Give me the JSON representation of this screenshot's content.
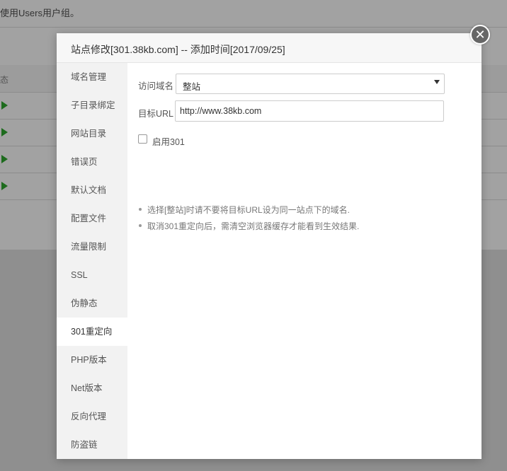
{
  "background": {
    "note": "使用Users用户组。",
    "table_header": "态"
  },
  "modal": {
    "title": "站点修改[301.38kb.com] -- 添加时间[2017/09/25]",
    "close_icon": "close-icon",
    "sidebar": {
      "items": [
        {
          "label": "域名管理",
          "active": false
        },
        {
          "label": "子目录绑定",
          "active": false
        },
        {
          "label": "网站目录",
          "active": false
        },
        {
          "label": "错误页",
          "active": false
        },
        {
          "label": "默认文档",
          "active": false
        },
        {
          "label": "配置文件",
          "active": false
        },
        {
          "label": "流量限制",
          "active": false
        },
        {
          "label": "SSL",
          "active": false
        },
        {
          "label": "伪静态",
          "active": false
        },
        {
          "label": "301重定向",
          "active": true
        },
        {
          "label": "PHP版本",
          "active": false
        },
        {
          "label": "Net版本",
          "active": false
        },
        {
          "label": "反向代理",
          "active": false
        },
        {
          "label": "防盗链",
          "active": false
        }
      ]
    },
    "form": {
      "domain_label": "访问域名",
      "domain_value": "整站",
      "target_label": "目标URL",
      "target_value": "http://www.38kb.com",
      "enable_label": "启用301",
      "enable_checked": false
    },
    "tips": [
      "选择[整站]时请不要将目标URL设为同一站点下的域名.",
      "取消301重定向后，需清空浏览器缓存才能看到生效结果."
    ]
  }
}
